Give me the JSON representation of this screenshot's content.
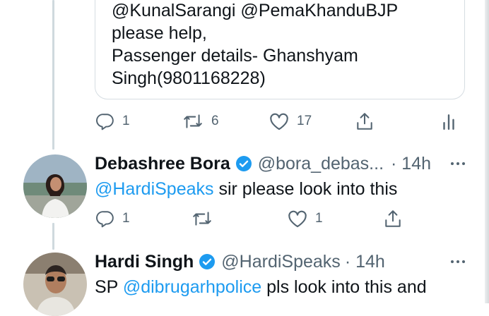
{
  "quoted_tweet": {
    "text_line1": "@KunalSarangi @PemaKhanduBJP",
    "text_line2": "please help,",
    "text_line3": "Passenger details- Ghanshyam",
    "text_line4": "Singh(9801168228)"
  },
  "main_actions": {
    "replies": "1",
    "retweets": "6",
    "likes": "17"
  },
  "reply1": {
    "name": "Debashree Bora",
    "handle": "@bora_debas...",
    "time": "· 14h",
    "mention": "@HardiSpeaks",
    "text": " sir please look into this",
    "actions": {
      "replies": "1",
      "retweets": "",
      "likes": "1"
    }
  },
  "reply2": {
    "name": "Hardi Singh",
    "handle": "@HardiSpeaks",
    "time": "· 14h",
    "prefix": "SP ",
    "mention": "@dibrugarhpolice",
    "text": " pls look into this and"
  },
  "colors": {
    "link": "#1d9bf0",
    "secondary": "#536471",
    "verified": "#1d9bf0",
    "thread_line": "#cfd9de"
  },
  "icons": [
    "reply-icon",
    "retweet-icon",
    "like-icon",
    "share-icon",
    "analytics-icon",
    "verified-badge-icon",
    "more-icon"
  ]
}
